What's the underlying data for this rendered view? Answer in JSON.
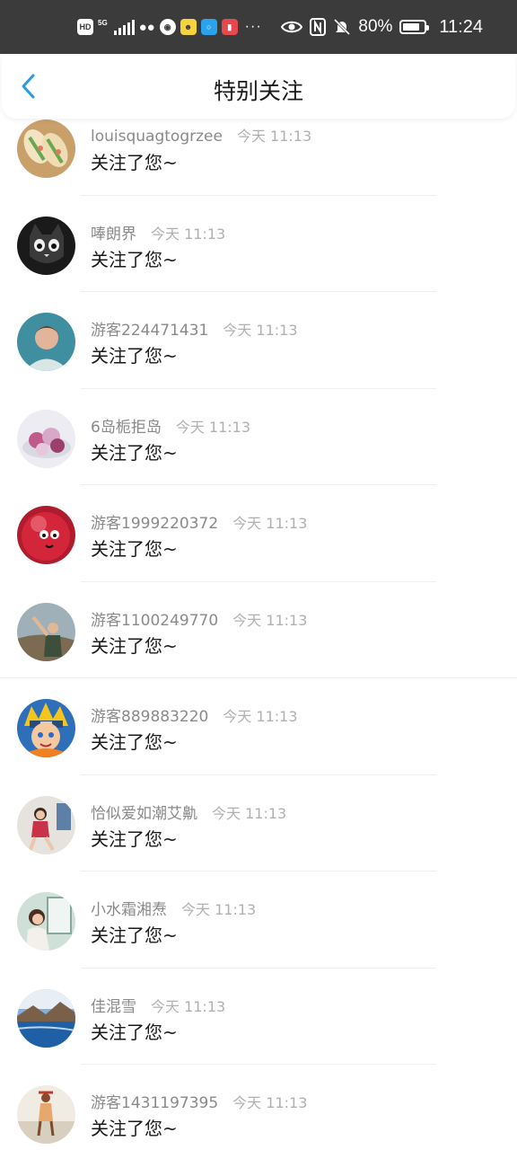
{
  "status_bar": {
    "icons": [
      "HD",
      "5G-signal",
      "wechat-icon",
      "app-icon",
      "qq-icon",
      "search-app-icon",
      "book-app-icon"
    ],
    "hd": "HD",
    "network": "5G",
    "more": "···",
    "battery": "80%",
    "battery_level": 0.8,
    "time": "11:24"
  },
  "header": {
    "title": "特别关注",
    "back_icon": "chevron-left-icon",
    "accent_color": "#2b9be6"
  },
  "items": [
    {
      "name": "louisquagtogrzee",
      "time": "今天 11:13",
      "message": "关注了您~",
      "avatar": "food-rolls"
    },
    {
      "name": "唪朗界",
      "time": "今天 11:13",
      "message": "关注了您~",
      "avatar": "black-cat"
    },
    {
      "name": "游客224471431",
      "time": "今天 11:13",
      "message": "关注了您~",
      "avatar": "painted-boy"
    },
    {
      "name": "6岛栀拒岛",
      "time": "今天 11:13",
      "message": "关注了您~",
      "avatar": "purple-desserts"
    },
    {
      "name": "游客1999220372",
      "time": "今天 11:13",
      "message": "关注了您~",
      "avatar": "red-ball-face"
    },
    {
      "name": "游客1100249770",
      "time": "今天 11:13",
      "message": "关注了您~",
      "avatar": "person-hill"
    },
    {
      "name": "游客889883220",
      "time": "今天 11:13",
      "message": "关注了您~",
      "avatar": "anime-ninja"
    },
    {
      "name": "恰似爱如潮艾鼽",
      "time": "今天 11:13",
      "message": "关注了您~",
      "avatar": "girl-room"
    },
    {
      "name": "小水霜湘焘",
      "time": "今天 11:13",
      "message": "关注了您~",
      "avatar": "girl-window"
    },
    {
      "name": "佳混雪",
      "time": "今天 11:13",
      "message": "关注了您~",
      "avatar": "lake-landscape"
    },
    {
      "name": "游客1431197395",
      "time": "今天 11:13",
      "message": "关注了您~",
      "avatar": "figure-sky"
    }
  ]
}
